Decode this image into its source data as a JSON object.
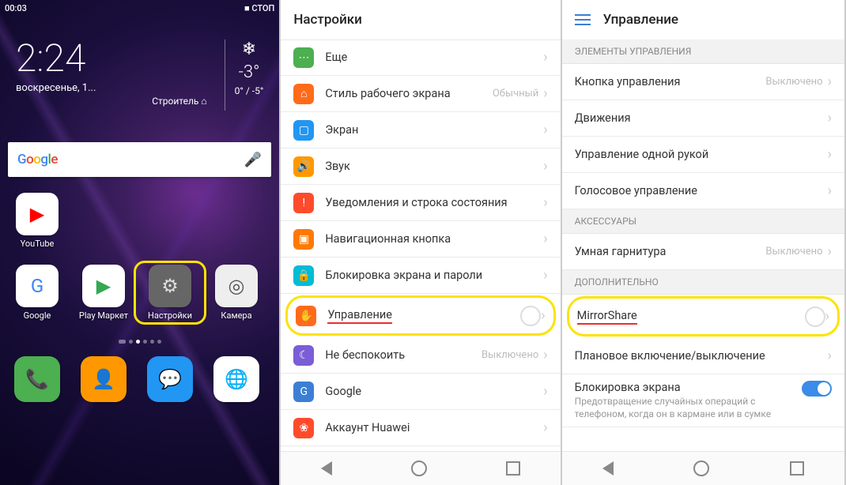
{
  "panel1": {
    "status_time": "00:03",
    "status_rec": "■ СТОП",
    "clock_time": "2:24",
    "clock_date": "воскресенье, 1...",
    "clock_loc": "Строитель ⌂",
    "weather_icon": "❄",
    "weather_temp": "-3°",
    "weather_range": "0° / -5°",
    "search_hint": "Google",
    "apps_row1": [
      {
        "label": "YouTube",
        "bg": "#fff",
        "ico": "▶",
        "icocolor": "#ff0000"
      }
    ],
    "apps_row2": [
      {
        "label": "Google",
        "bg": "#fff",
        "ico": "G",
        "icocolor": "#4285f4"
      },
      {
        "label": "Play Маркет",
        "bg": "#fff",
        "ico": "▶",
        "icocolor": "#34a853"
      },
      {
        "label": "Настройки",
        "bg": "#666",
        "ico": "⚙",
        "icocolor": "#ddd",
        "highlight": true
      },
      {
        "label": "Камера",
        "bg": "#eee",
        "ico": "◎",
        "icocolor": "#555"
      }
    ],
    "dock": [
      {
        "bg": "#4caf50",
        "ico": "📞"
      },
      {
        "bg": "#ff9800",
        "ico": "👤"
      },
      {
        "bg": "#2196f3",
        "ico": "💬"
      },
      {
        "bg": "#fff",
        "ico": "🌐"
      }
    ]
  },
  "panel2": {
    "title": "Настройки",
    "items": [
      {
        "ico": "ic-green",
        "glyph": "⋯",
        "label": "Еще"
      },
      {
        "ico": "ic-orange1",
        "glyph": "⌂",
        "label": "Стиль рабочего экрана",
        "value": "Обычный"
      },
      {
        "ico": "ic-blue",
        "glyph": "▢",
        "label": "Экран"
      },
      {
        "ico": "ic-orange2",
        "glyph": "🔊",
        "label": "Звук"
      },
      {
        "ico": "ic-red",
        "glyph": "!",
        "label": "Уведомления и строка состояния"
      },
      {
        "ico": "ic-orange3",
        "glyph": "▣",
        "label": "Навигационная кнопка"
      },
      {
        "ico": "ic-cyan",
        "glyph": "🔒",
        "label": "Блокировка экрана и пароли"
      },
      {
        "ico": "ic-orange4",
        "glyph": "✋",
        "label": "Управление",
        "highlight": true,
        "underline": true,
        "radio": true
      },
      {
        "ico": "ic-purple",
        "glyph": "☾",
        "label": "Не беспокоить",
        "value": "Выключено"
      },
      {
        "ico": "ic-blue2",
        "glyph": "G",
        "label": "Google"
      },
      {
        "ico": "ic-huawei",
        "glyph": "❀",
        "label": "Аккаунт Huawei"
      }
    ]
  },
  "panel3": {
    "title": "Управление",
    "sections": [
      {
        "header": "ЭЛЕМЕНТЫ УПРАВЛЕНИЯ",
        "items": [
          {
            "label": "Кнопка управления",
            "value": "Выключено"
          },
          {
            "label": "Движения"
          },
          {
            "label": "Управление одной рукой"
          },
          {
            "label": "Голосовое управление"
          }
        ]
      },
      {
        "header": "АКСЕССУАРЫ",
        "items": [
          {
            "label": "Умная гарнитура",
            "value": "Выключено"
          }
        ]
      },
      {
        "header": "ДОПОЛНИТЕЛЬНО",
        "items": [
          {
            "label": "MirrorShare",
            "highlight": true,
            "underline": true,
            "radio": true
          },
          {
            "label": "Плановое включение/выключение"
          },
          {
            "label": "Блокировка экрана",
            "subtitle": "Предотвращение случайных операций с телефоном, когда он в кармане или в сумке",
            "toggle": true
          }
        ]
      }
    ]
  }
}
